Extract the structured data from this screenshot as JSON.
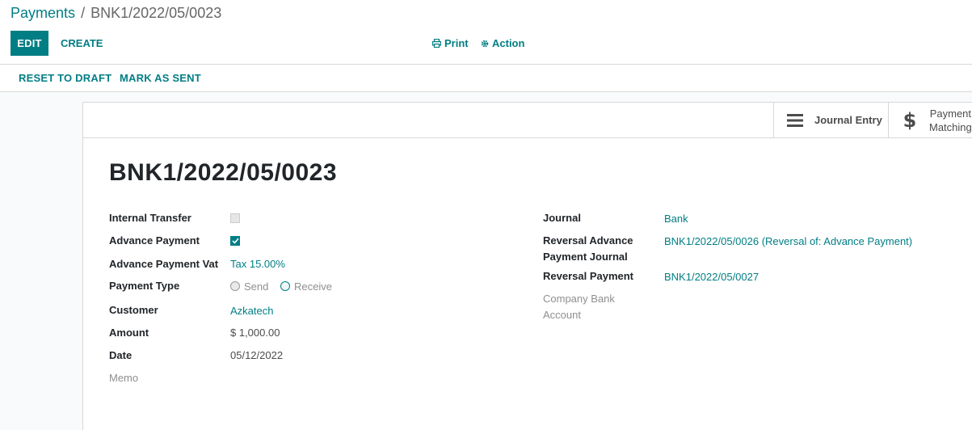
{
  "breadcrumb": {
    "parent": "Payments",
    "separator": "/",
    "current": "BNK1/2022/05/0023"
  },
  "toolbar": {
    "edit_label": "EDIT",
    "create_label": "CREATE",
    "print_label": "Print",
    "action_label": "Action"
  },
  "statusbar": {
    "reset_label": "RESET TO DRAFT",
    "mark_sent_label": "MARK AS SENT"
  },
  "smart_buttons": {
    "journal_entry": "Journal Entry",
    "payment_matching_line1": "Payment",
    "payment_matching_line2": "Matching"
  },
  "record": {
    "title": "BNK1/2022/05/0023"
  },
  "left_fields": {
    "internal_transfer_label": "Internal Transfer",
    "internal_transfer_checked": false,
    "advance_payment_label": "Advance Payment",
    "advance_payment_checked": true,
    "advance_payment_vat_label": "Advance Payment Vat",
    "advance_payment_vat_value": "Tax 15.00%",
    "payment_type_label": "Payment Type",
    "payment_type_send": "Send",
    "payment_type_receive": "Receive",
    "customer_label": "Customer",
    "customer_value": "Azkatech",
    "amount_label": "Amount",
    "amount_value": "$ 1,000.00",
    "date_label": "Date",
    "date_value": "05/12/2022",
    "memo_label": "Memo"
  },
  "right_fields": {
    "journal_label": "Journal",
    "journal_value": "Bank",
    "reversal_advance_label_line1": "Reversal Advance",
    "reversal_advance_label_line2": "Payment Journal",
    "reversal_advance_value": "BNK1/2022/05/0026 (Reversal of: Advance Payment)",
    "reversal_payment_label": "Reversal Payment",
    "reversal_payment_value": "BNK1/2022/05/0027",
    "company_bank_label_line1": "Company Bank",
    "company_bank_label_line2": "Account"
  },
  "colors": {
    "accent": "#017e84",
    "text": "#4c4c4c",
    "muted": "#8f8f8f",
    "border": "#d8d8d8"
  }
}
